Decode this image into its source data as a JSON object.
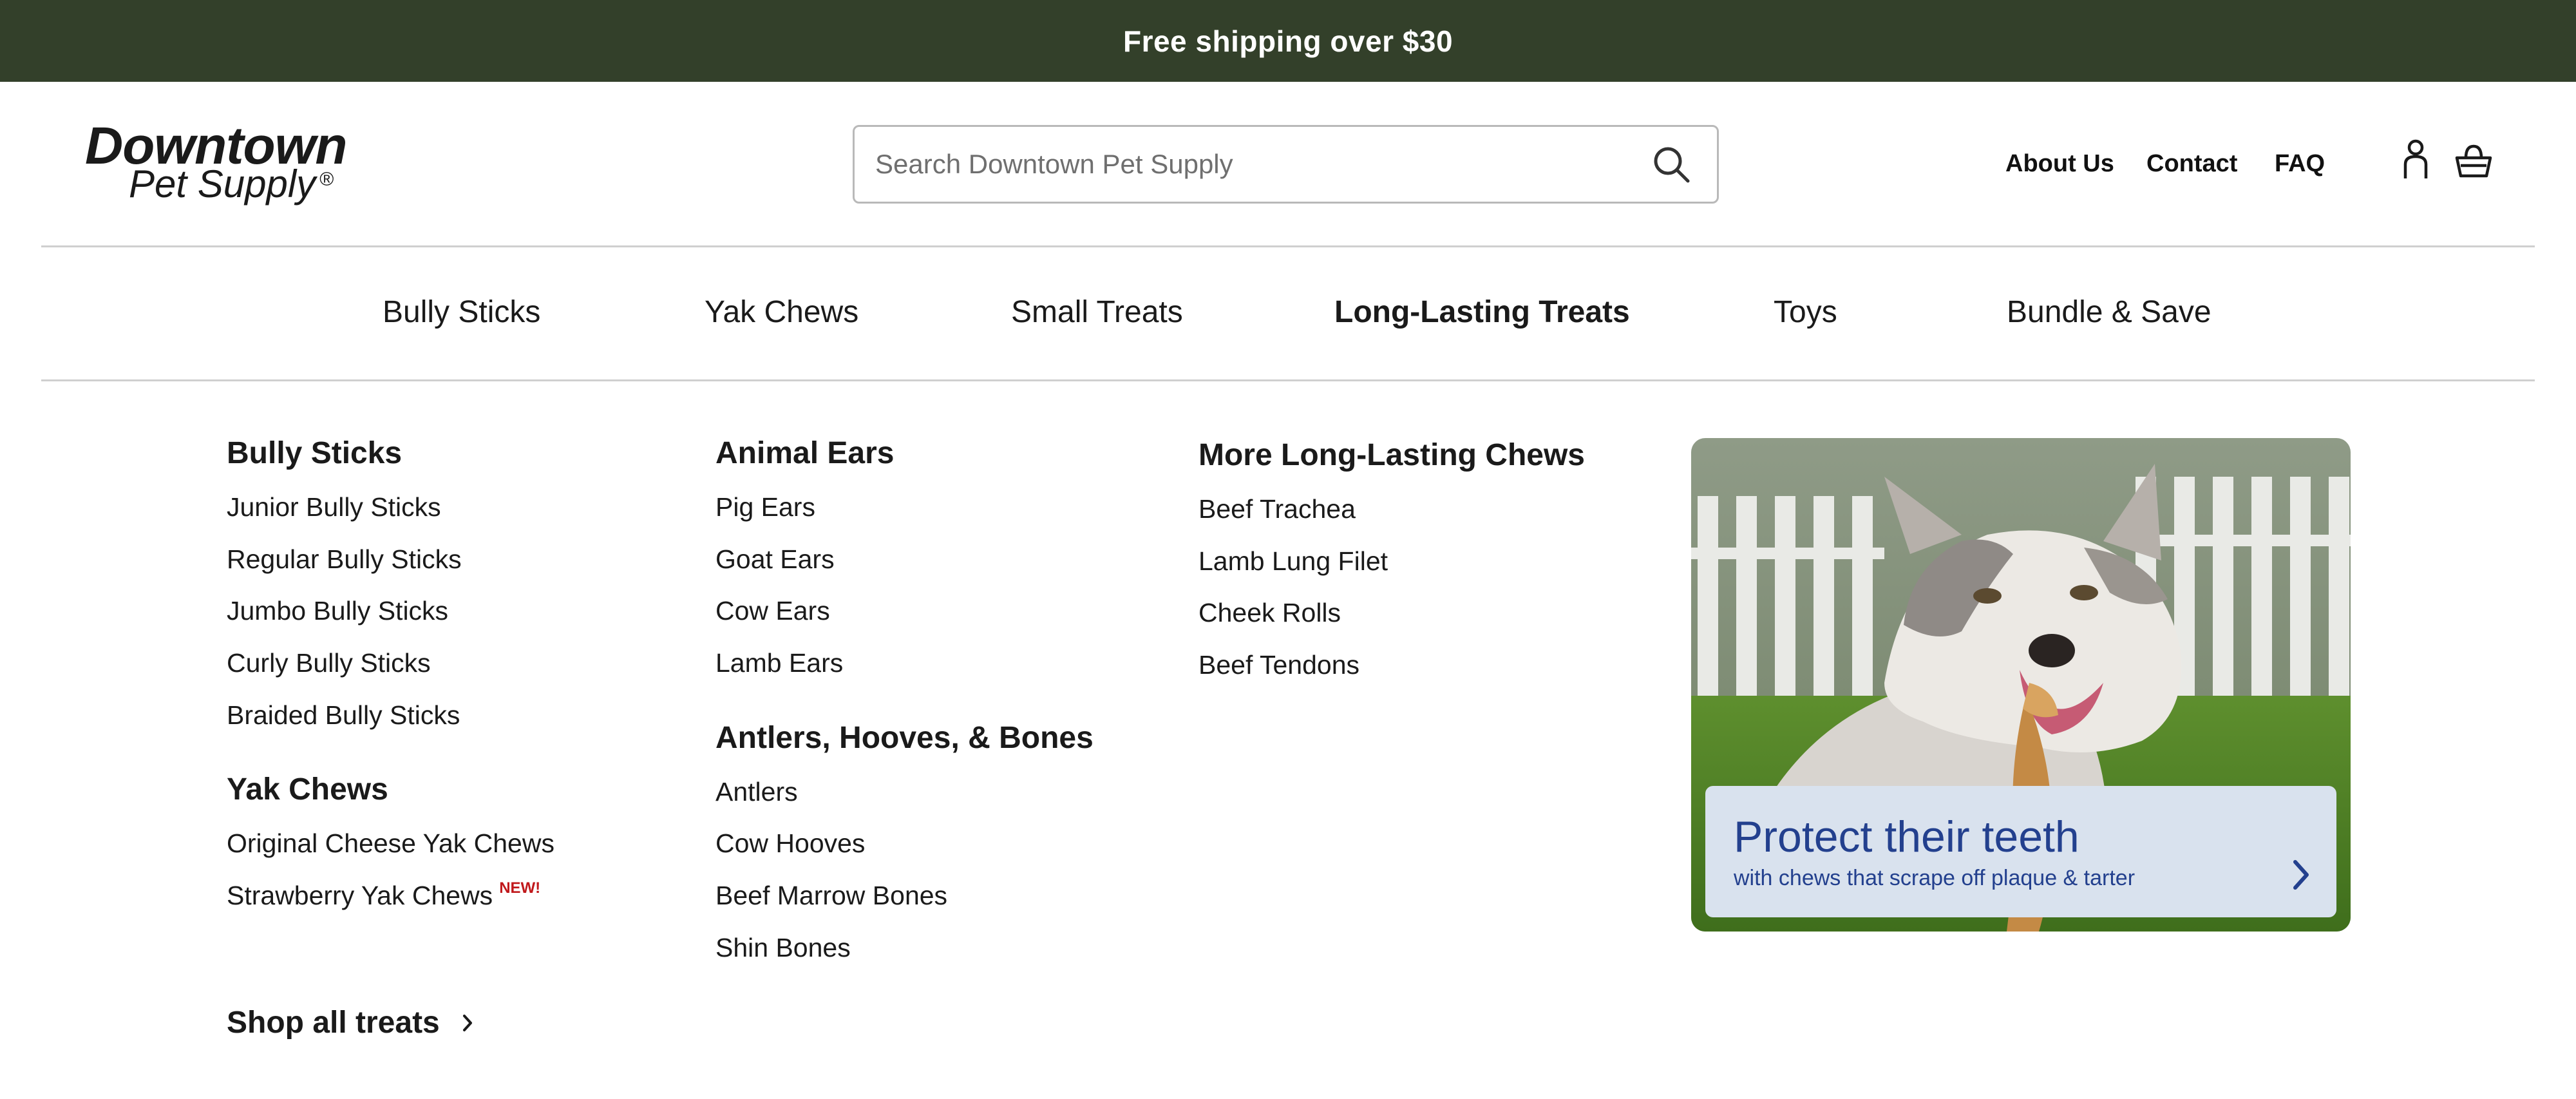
{
  "announcement": "Free shipping over $30",
  "logo": {
    "line1": "Downtown",
    "line2": "Pet Supply",
    "reg": "®"
  },
  "search": {
    "placeholder": "Search Downtown Pet Supply",
    "icon": "search-icon"
  },
  "header_links": [
    "About Us",
    "Contact",
    "FAQ"
  ],
  "header_icons": [
    "account-icon",
    "cart-icon"
  ],
  "nav": {
    "items": [
      "Bully Sticks",
      "Yak Chews",
      "Small Treats",
      "Long-Lasting Treats",
      "Toys",
      "Bundle & Save"
    ],
    "active": "Long-Lasting Treats"
  },
  "mega": {
    "col1": {
      "groups": [
        {
          "heading": "Bully Sticks",
          "links": [
            "Junior Bully Sticks",
            "Regular Bully Sticks",
            "Jumbo Bully Sticks",
            "Curly Bully Sticks",
            "Braided Bully Sticks"
          ]
        },
        {
          "heading": "Yak Chews",
          "links": [
            "Original Cheese Yak Chews",
            "Strawberry Yak Chews"
          ]
        }
      ],
      "new_badge": "NEW!"
    },
    "col2": {
      "groups": [
        {
          "heading": "Animal Ears",
          "links": [
            "Pig Ears",
            "Goat Ears",
            "Cow Ears",
            "Lamb Ears"
          ]
        },
        {
          "heading": "Antlers, Hooves, & Bones",
          "links": [
            "Antlers",
            "Cow Hooves",
            "Beef Marrow Bones",
            "Shin Bones"
          ]
        }
      ]
    },
    "col3": {
      "groups": [
        {
          "heading": "More Long-Lasting Chews",
          "links": [
            "Beef Trachea",
            "Lamb Lung Filet",
            "Cheek Rolls",
            "Beef Tendons"
          ]
        }
      ]
    },
    "shop_all": "Shop all treats"
  },
  "promo": {
    "title": "Protect their teeth",
    "subtitle": "with chews that scrape off plaque & tarter",
    "colors": {
      "card": "#d9e2ee",
      "text": "#23408e"
    }
  },
  "colors": {
    "announcement_bg": "#33402a",
    "rule": "#cfcfcf",
    "new_badge": "#c0181b"
  }
}
